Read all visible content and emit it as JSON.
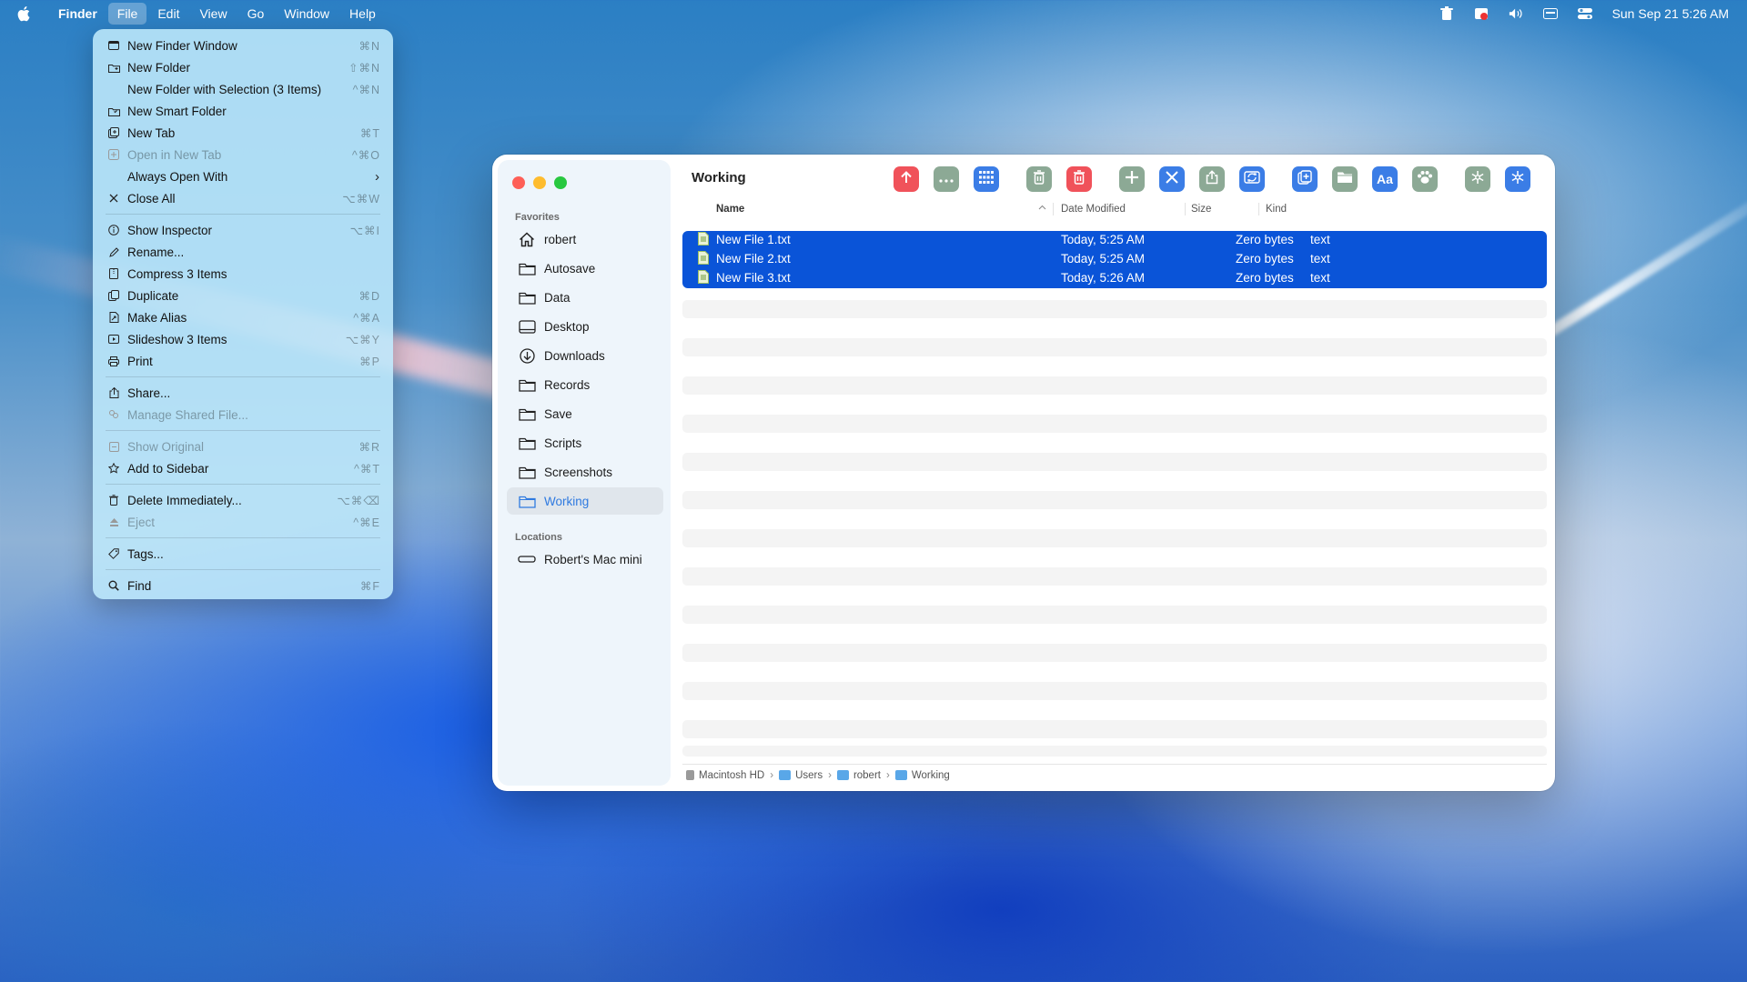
{
  "menubar": {
    "app_name": "Finder",
    "items": [
      "File",
      "Edit",
      "View",
      "Go",
      "Window",
      "Help"
    ],
    "clock": "Sun Sep 21  5:26 AM"
  },
  "file_menu": {
    "items": [
      {
        "label": "New Finder Window",
        "shortcut": "⌘N",
        "icon": "new-window-icon"
      },
      {
        "label": "New Folder",
        "shortcut": "⇧⌘N",
        "icon": "new-folder-icon"
      },
      {
        "label": "New Folder with Selection (3 Items)",
        "shortcut": "^⌘N",
        "icon": ""
      },
      {
        "label": "New Smart Folder",
        "shortcut": "",
        "icon": "smart-folder-icon"
      },
      {
        "label": "New Tab",
        "shortcut": "⌘T",
        "icon": "new-tab-icon"
      },
      {
        "label": "Open in New Tab",
        "shortcut": "^⌘O",
        "icon": "open-tab-icon",
        "disabled": true
      },
      {
        "label": "Always Open With",
        "shortcut": "›",
        "icon": ""
      },
      {
        "label": "Close All",
        "shortcut": "⌥⌘W",
        "icon": "close-icon"
      },
      {
        "label": "Show Inspector",
        "shortcut": "⌥⌘I",
        "icon": "info-icon"
      },
      {
        "label": "Rename...",
        "shortcut": "",
        "icon": "pencil-icon"
      },
      {
        "label": "Compress 3 Items",
        "shortcut": "",
        "icon": "archive-icon"
      },
      {
        "label": "Duplicate",
        "shortcut": "⌘D",
        "icon": "duplicate-icon"
      },
      {
        "label": "Make Alias",
        "shortcut": "^⌘A",
        "icon": "alias-icon"
      },
      {
        "label": "Slideshow 3 Items",
        "shortcut": "⌥⌘Y",
        "icon": "slideshow-icon"
      },
      {
        "label": "Print",
        "shortcut": "⌘P",
        "icon": "print-icon"
      },
      {
        "label": "Share...",
        "shortcut": "",
        "icon": "share-icon"
      },
      {
        "label": "Manage Shared File...",
        "shortcut": "",
        "icon": "shared-file-icon",
        "disabled": true
      },
      {
        "label": "Show Original",
        "shortcut": "⌘R",
        "icon": "original-icon",
        "disabled": true
      },
      {
        "label": "Add to Sidebar",
        "shortcut": "^⌘T",
        "icon": "star-icon"
      },
      {
        "label": "Delete Immediately...",
        "shortcut": "⌥⌘⌫",
        "icon": "trash-icon"
      },
      {
        "label": "Eject",
        "shortcut": "^⌘E",
        "icon": "eject-icon",
        "disabled": true
      },
      {
        "label": "Tags...",
        "shortcut": "",
        "icon": "tag-icon"
      },
      {
        "label": "Find",
        "shortcut": "⌘F",
        "icon": "search-icon"
      }
    ]
  },
  "window": {
    "title": "Working",
    "sidebar": {
      "favorites_label": "Favorites",
      "favorites": [
        "robert",
        "Autosave",
        "Data",
        "Desktop",
        "Downloads",
        "Records",
        "Save",
        "Scripts",
        "Screenshots",
        "Working"
      ],
      "locations_label": "Locations",
      "locations": [
        "Robert's Mac mini"
      ]
    },
    "columns": {
      "name": "Name",
      "date": "Date Modified",
      "size": "Size",
      "kind": "Kind"
    },
    "files": [
      {
        "name": "New File 1.txt",
        "date": "Today, 5:25 AM",
        "size": "Zero bytes",
        "kind": "text"
      },
      {
        "name": "New File 2.txt",
        "date": "Today, 5:25 AM",
        "size": "Zero bytes",
        "kind": "text"
      },
      {
        "name": "New File 3.txt",
        "date": "Today, 5:26 AM",
        "size": "Zero bytes",
        "kind": "text"
      }
    ],
    "path": [
      "Macintosh HD",
      "Users",
      "robert",
      "Working"
    ]
  },
  "colors": {
    "selection": "#0a54d8",
    "accent": "#2f7ae0"
  }
}
